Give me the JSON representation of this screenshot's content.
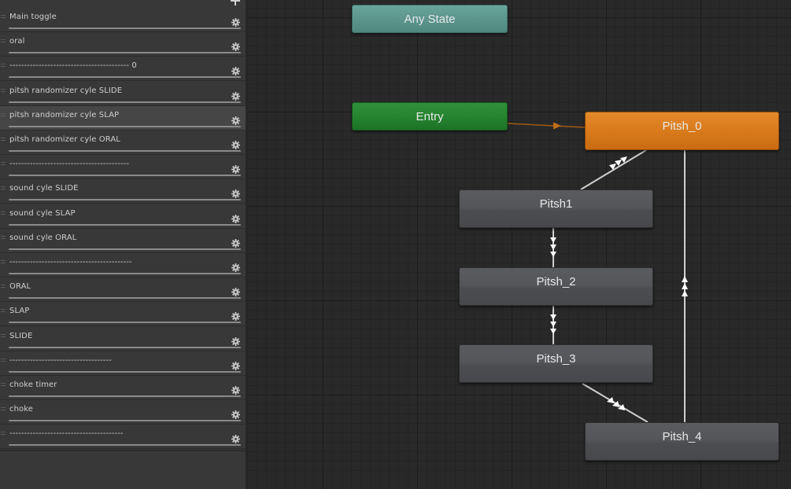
{
  "parameters": {
    "items": [
      {
        "label": "Main toggle",
        "selected": false
      },
      {
        "label": "oral",
        "selected": false
      },
      {
        "label": "----------------------------------------- 0",
        "selected": false
      },
      {
        "label": "pitsh randomizer cyle SLIDE",
        "selected": false
      },
      {
        "label": "pitsh randomizer cyle SLAP",
        "selected": true
      },
      {
        "label": "pitsh randomizer cyle ORAL",
        "selected": false
      },
      {
        "label": "-----------------------------------------",
        "selected": false
      },
      {
        "label": "sound cyle SLIDE",
        "selected": false
      },
      {
        "label": "sound cyle SLAP",
        "selected": false
      },
      {
        "label": "sound cyle ORAL",
        "selected": false
      },
      {
        "label": "------------------------------------------",
        "selected": false
      },
      {
        "label": "ORAL",
        "selected": false
      },
      {
        "label": "SLAP",
        "selected": false
      },
      {
        "label": "SLIDE",
        "selected": false
      },
      {
        "label": "-----------------------------------",
        "selected": false
      },
      {
        "label": "choke timer",
        "selected": false
      },
      {
        "label": "choke",
        "selected": false
      },
      {
        "label": "---------------------------------------",
        "selected": false
      }
    ]
  },
  "graph": {
    "states": {
      "any_state": {
        "label": "Any State"
      },
      "entry": {
        "label": "Entry"
      },
      "pitsh_0": {
        "label": "Pitsh_0"
      },
      "pitsh1": {
        "label": "Pitsh1"
      },
      "pitsh_2": {
        "label": "Pitsh_2"
      },
      "pitsh_3": {
        "label": "Pitsh_3"
      },
      "pitsh_4": {
        "label": "Pitsh_4"
      }
    }
  },
  "colors": {
    "default_state": "#54565a",
    "any_state": "#5c968d",
    "entry": "#26842f",
    "default_highlight": "#d97a1c"
  }
}
